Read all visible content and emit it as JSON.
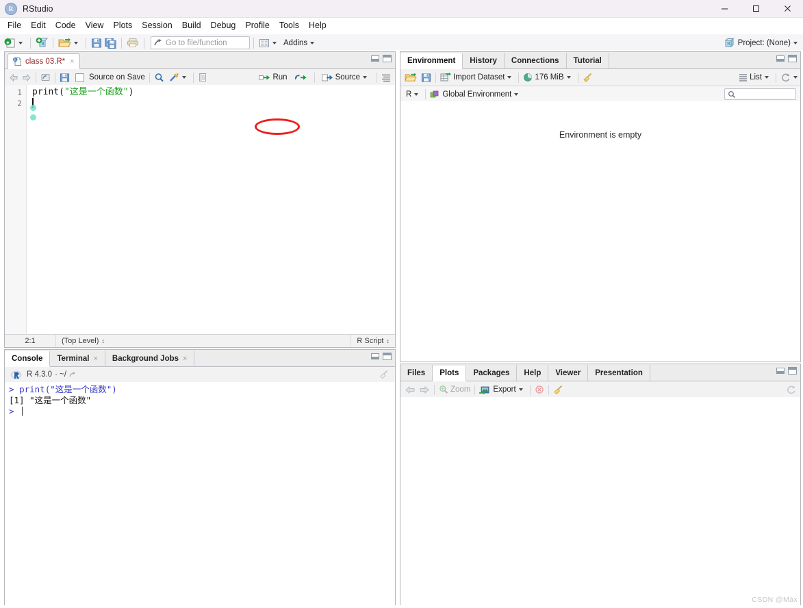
{
  "window": {
    "app_title": "RStudio",
    "app_icon": "R",
    "minimize": "minimize-icon",
    "maximize": "maximize-icon",
    "close": "close-icon"
  },
  "menubar": {
    "items": [
      {
        "label": "File"
      },
      {
        "label": "Edit"
      },
      {
        "label": "Code"
      },
      {
        "label": "View"
      },
      {
        "label": "Plots"
      },
      {
        "label": "Session"
      },
      {
        "label": "Build"
      },
      {
        "label": "Debug"
      },
      {
        "label": "Profile"
      },
      {
        "label": "Tools"
      },
      {
        "label": "Help"
      }
    ]
  },
  "toolbar": {
    "new_file": "new-file-icon",
    "new_project": "new-project-icon",
    "open_file": "open-folder-icon",
    "save": "save-icon",
    "save_all": "save-all-icon",
    "print": "print-icon",
    "goto_placeholder": "Go to file/function",
    "panes_icon": "panes-layout-icon",
    "addins_label": "Addins",
    "project_label": "Project: (None)"
  },
  "source": {
    "tab": {
      "label": "class 03.R*",
      "close": "×"
    },
    "toolbar": {
      "back": "back-arrow-icon",
      "forward": "forward-arrow-icon",
      "popout": "show-in-new-window-icon",
      "save": "save-icon",
      "source_on_save_label": "Source on Save",
      "find": "find-icon",
      "wand": "code-tools-icon",
      "compile_report": "compile-report-icon",
      "run_label": "Run",
      "rerun": "rerun-icon",
      "source_label": "Source",
      "outline": "document-outline-icon"
    },
    "lines": [
      {
        "number": "1",
        "text": "print(\"这是一个函数\")"
      },
      {
        "number": "2",
        "text": ""
      }
    ],
    "code_segments": {
      "fn": "print(",
      "str": "\"这是一个函数\"",
      "close": ")"
    },
    "status": {
      "position": "2:1",
      "scope": "(Top Level)",
      "file_type": "R Script"
    }
  },
  "environment": {
    "tabs": [
      {
        "label": "Environment",
        "active": true
      },
      {
        "label": "History",
        "active": false
      },
      {
        "label": "Connections",
        "active": false
      },
      {
        "label": "Tutorial",
        "active": false
      }
    ],
    "toolbar": {
      "load_workspace": "open-folder-icon",
      "save_workspace": "save-icon",
      "import_dataset_label": "Import Dataset",
      "memory_label": "176 MiB",
      "clear_label": "broom-clear-icon",
      "view_mode_label": "List",
      "refresh": "refresh-icon"
    },
    "selector": {
      "language_label": "R",
      "scope_label": "Global Environment",
      "search_placeholder": ""
    },
    "empty_message": "Environment is empty"
  },
  "console": {
    "tabs": [
      {
        "label": "Console",
        "active": true,
        "closable": false
      },
      {
        "label": "Terminal",
        "active": false,
        "closable": true
      },
      {
        "label": "Background Jobs",
        "active": false,
        "closable": true
      }
    ],
    "version_label": "R 4.3.0",
    "path_label": "· ~/",
    "clear_icon": "broom-clear-icon",
    "output": [
      {
        "type": "input",
        "prompt": "> ",
        "text": "print(\"这是一个函数\")"
      },
      {
        "type": "output",
        "prompt": "",
        "text": "[1] \"这是一个函数\""
      },
      {
        "type": "prompt",
        "prompt": "> ",
        "text": ""
      }
    ]
  },
  "files": {
    "tabs": [
      {
        "label": "Files",
        "active": false
      },
      {
        "label": "Plots",
        "active": true
      },
      {
        "label": "Packages",
        "active": false
      },
      {
        "label": "Help",
        "active": false
      },
      {
        "label": "Viewer",
        "active": false
      },
      {
        "label": "Presentation",
        "active": false
      }
    ],
    "toolbar": {
      "back": "back-arrow-icon",
      "forward": "forward-arrow-icon",
      "zoom_label": "Zoom",
      "export_label": "Export",
      "remove_plot": "remove-plot-icon",
      "clear_all": "broom-clear-icon",
      "refresh": "refresh-icon"
    }
  },
  "annotation": {
    "highlight_target": "Run",
    "highlight_color": "#ee1b1b"
  },
  "watermark": "CSDN @Màx"
}
